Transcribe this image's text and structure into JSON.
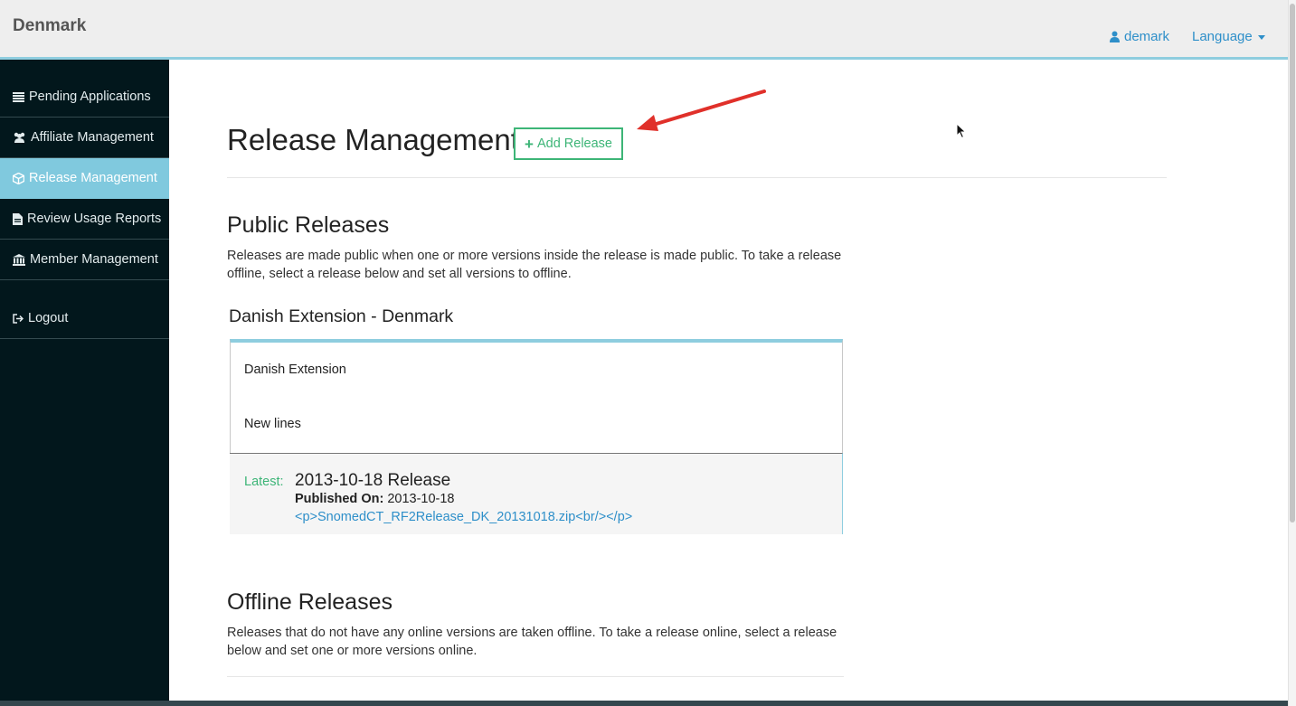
{
  "header": {
    "brand": "Denmark",
    "user": "demark",
    "language": "Language"
  },
  "sidebar": {
    "items": [
      {
        "label": "Pending Applications",
        "icon": "list-icon",
        "active": false
      },
      {
        "label": "Affiliate Management",
        "icon": "users-icon",
        "active": false
      },
      {
        "label": "Release Management",
        "icon": "cube-icon",
        "active": true
      },
      {
        "label": "Review Usage Reports",
        "icon": "document-icon",
        "active": false
      },
      {
        "label": "Member Management",
        "icon": "bank-icon",
        "active": false
      }
    ],
    "logout": "Logout"
  },
  "main": {
    "title": "Release Management",
    "add_button": "Add Release",
    "public": {
      "title": "Public Releases",
      "description": "Releases are made public when one or more versions inside the release is made public. To take a release offline, select a release below and set all versions to offline."
    },
    "release": {
      "name": "Danish Extension - Denmark",
      "line1": "Danish Extension",
      "line2": "New lines",
      "latest_label": "Latest:",
      "version_title": "2013-10-18 Release",
      "published_label": "Published On:",
      "published_date": "2013-10-18",
      "file_link": "<p>SnomedCT_RF2Release_DK_20131018.zip<br/></p>"
    },
    "offline": {
      "title": "Offline Releases",
      "description": "Releases that do not have any online versions are taken offline. To take a release online, select a release below and set one or more versions online."
    }
  },
  "colors": {
    "accent": "#80c9de",
    "sidebar_bg": "#02171c",
    "link": "#2e8fc9",
    "green": "#3db577",
    "arrow": "#e0302a"
  }
}
